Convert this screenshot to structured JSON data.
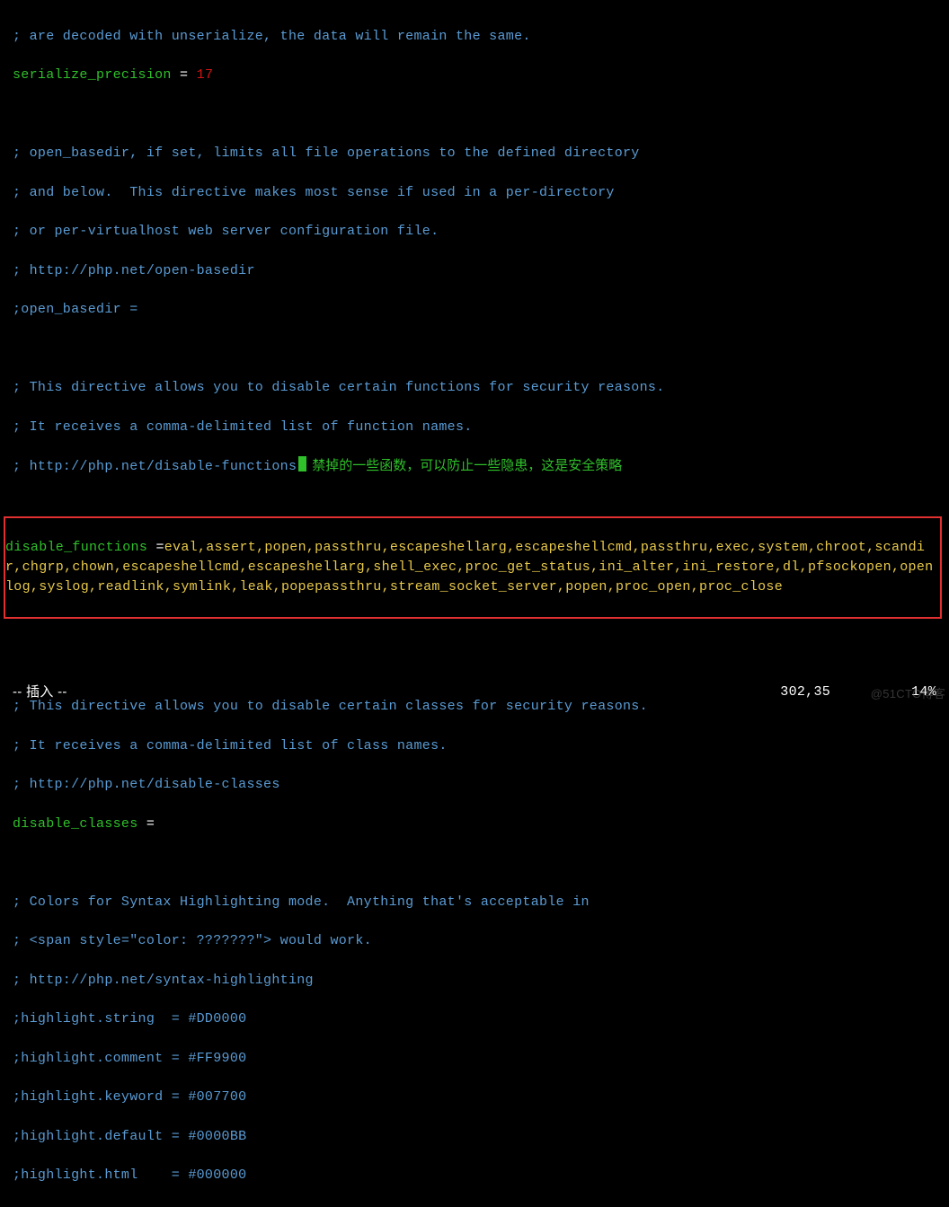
{
  "line00_comment": "; are decoded with unserialize, the data will remain the same.",
  "serialize_precision_key": "serialize_precision",
  "serialize_precision_eq": " = ",
  "serialize_precision_val": "17",
  "ob_l1": "; open_basedir, if set, limits all file operations to the defined directory",
  "ob_l2": "; and below.  This directive makes most sense if used in a per-directory",
  "ob_l3": "; or per-virtualhost web server configuration file.",
  "ob_l4": "; http://php.net/open-basedir",
  "ob_l5": ";open_basedir =",
  "df_c1": "; This directive allows you to disable certain functions for security reasons.",
  "df_c2": "; It receives a comma-delimited list of function names.",
  "df_c3": "; http://php.net/disable-functions",
  "df_cn": "禁掉的一些函数，可以防止一些隐患，这是安全策略",
  "df_key": "disable_functions ",
  "df_eq": "=",
  "df_val": "eval,assert,popen,passthru,escapeshellarg,escapeshellcmd,passthru,exec,system,chroot,scandir,chgrp,chown,escapeshellcmd,escapeshellarg,shell_exec,proc_get_status,ini_alter,ini_restore,dl,pfsockopen,openlog,syslog,readlink,symlink,leak,popepassthru,stream_socket_server,popen,proc_open,proc_close",
  "dc_c1": "; This directive allows you to disable certain classes for security reasons.",
  "dc_c2": "; It receives a comma-delimited list of class names.",
  "dc_c3": "; http://php.net/disable-classes",
  "dc_key": "disable_classes",
  "dc_eq": " =",
  "sh_c1": "; Colors for Syntax Highlighting mode.  Anything that's acceptable in",
  "sh_c2": "; <span style=\"color: ???????\"> would work.",
  "sh_c3": "; http://php.net/syntax-highlighting",
  "sh_l1": ";highlight.string  = #DD0000",
  "sh_l2": ";highlight.comment = #FF9900",
  "sh_l3": ";highlight.keyword = #007700",
  "sh_l4": ";highlight.default = #0000BB",
  "sh_l5": ";highlight.html    = #000000",
  "status_mode": "-- 插入 --",
  "status_pos": "302,35",
  "status_pct": "14%",
  "watermark": "@51CTO博客"
}
